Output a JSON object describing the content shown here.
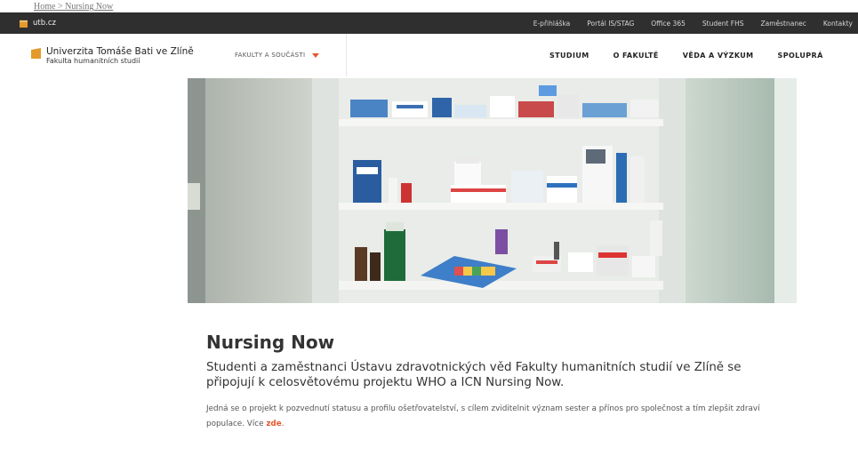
{
  "breadcrumb": {
    "home": "Home",
    "sep": ">",
    "current": "Nursing Now"
  },
  "topbar": {
    "site": "utb.cz",
    "links": [
      "E-přihláška",
      "Portál IS/STAG",
      "Office 365",
      "Student FHS",
      "Zaměstnanec",
      "Kontakty"
    ]
  },
  "brand": {
    "name": "Univerzita Tomáše Bati ve Zlíně",
    "faculty": "Fakulta humanitních studií",
    "logo_color": "#e39a2a"
  },
  "nav": {
    "faculties": "FAKULTY A SOUČÁSTI",
    "items": [
      "STUDIUM",
      "O FAKULTĚ",
      "VĚDA A VÝZKUM",
      "SPOLUPRÁ"
    ]
  },
  "article": {
    "title": "Nursing Now",
    "lead": "Studenti a zaměstnanci Ústavu zdravotnických věd Fakulty humanitních studií ve Zlíně se připojují k celosvětovému projektu WHO a ICN Nursing Now.",
    "body": "Jedná se o projekt k pozvednutí statusu a profilu ošetřovatelství, s cílem zviditelnit význam sester a přínos pro společnost a tím zlepšit zdraví populace. Více",
    "link": "zde",
    "tail": "."
  },
  "colors": {
    "accent": "#e4572e",
    "topbar": "#2f2f2f"
  }
}
